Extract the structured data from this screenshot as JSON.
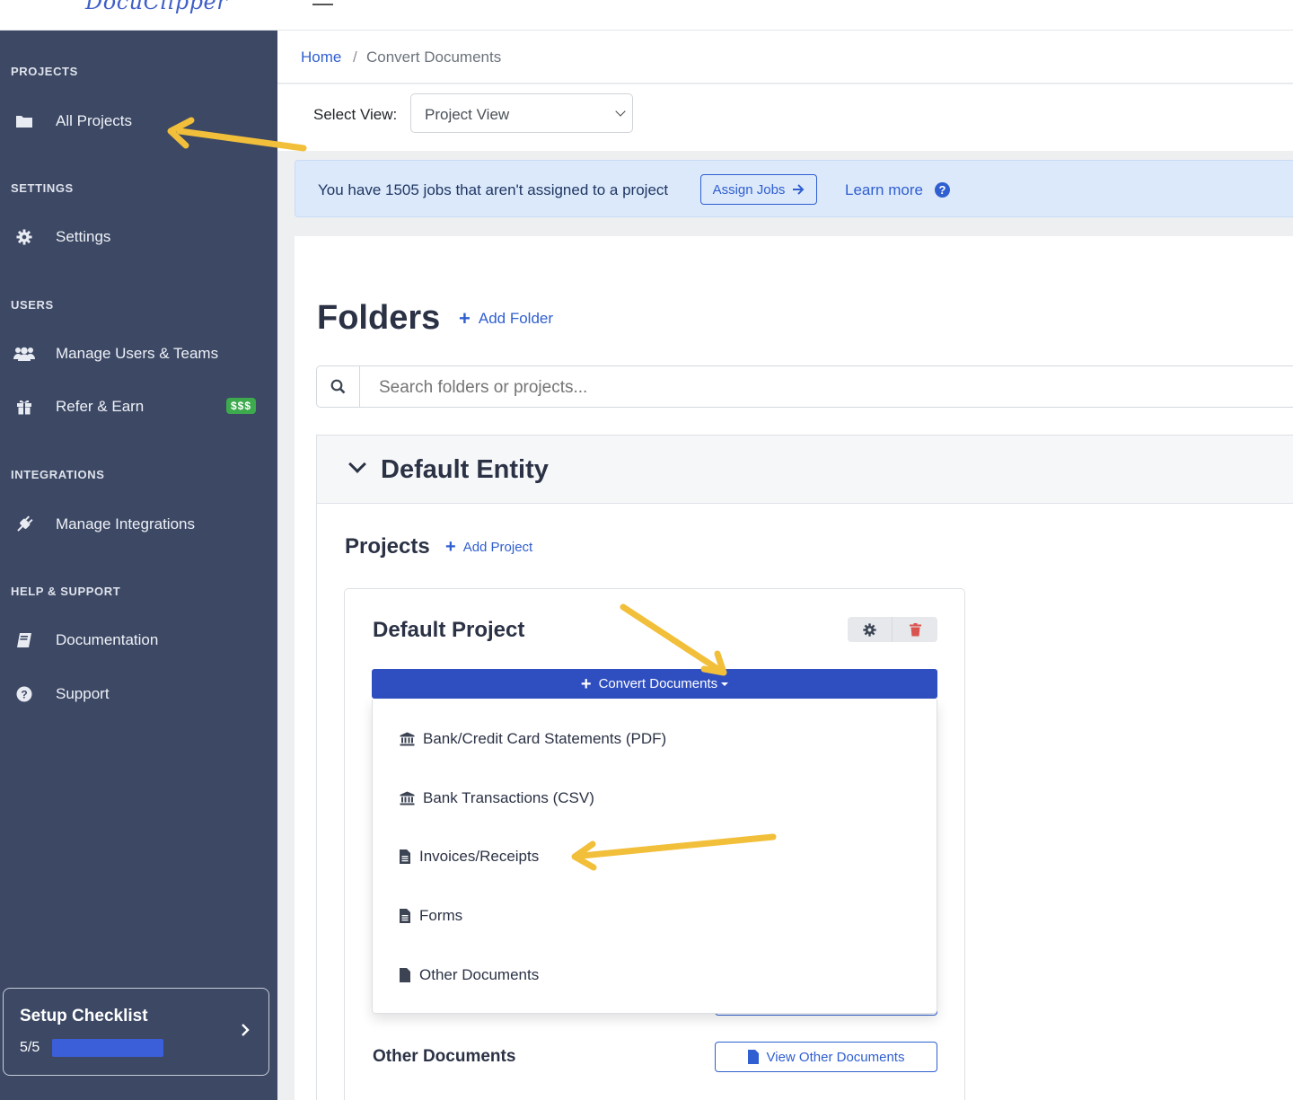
{
  "topbar": {
    "logo_text": "DocuClipper"
  },
  "sidebar": {
    "sections": [
      {
        "heading": "PROJECTS",
        "items": [
          {
            "label": "All Projects",
            "icon": "folder-icon"
          }
        ]
      },
      {
        "heading": "SETTINGS",
        "items": [
          {
            "label": "Settings",
            "icon": "gear-icon"
          }
        ]
      },
      {
        "heading": "USERS",
        "items": [
          {
            "label": "Manage Users & Teams",
            "icon": "users-icon"
          },
          {
            "label": "Refer & Earn",
            "icon": "gift-icon",
            "badge": "$$$"
          }
        ]
      },
      {
        "heading": "INTEGRATIONS",
        "items": [
          {
            "label": "Manage Integrations",
            "icon": "plug-icon"
          }
        ]
      },
      {
        "heading": "HELP & SUPPORT",
        "items": [
          {
            "label": "Documentation",
            "icon": "book-icon"
          },
          {
            "label": "Support",
            "icon": "question-circle-icon"
          }
        ]
      }
    ],
    "checklist": {
      "title": "Setup Checklist",
      "count": "5/5",
      "progress": 1.0
    }
  },
  "breadcrumb": {
    "home": "Home",
    "separator": "/",
    "current": "Convert Documents"
  },
  "view": {
    "label": "Select View:",
    "selected": "Project View"
  },
  "alert": {
    "text": "You have 1505 jobs that aren't assigned to a project",
    "assign_button": "Assign Jobs",
    "learn_more": "Learn more"
  },
  "folders": {
    "title": "Folders",
    "add_folder": "Add Folder",
    "search_placeholder": "Search folders or projects..."
  },
  "entity": {
    "title": "Default Entity",
    "projects_title": "Projects",
    "add_project": "Add Project",
    "project": {
      "title": "Default Project",
      "convert_button": "Convert Documents",
      "menu": [
        {
          "label": "Bank/Credit Card Statements (PDF)",
          "icon": "bank-icon"
        },
        {
          "label": "Bank Transactions (CSV)",
          "icon": "bank-icon"
        },
        {
          "label": "Invoices/Receipts",
          "icon": "file-text-icon"
        },
        {
          "label": "Forms",
          "icon": "file-text-icon"
        },
        {
          "label": "Other Documents",
          "icon": "file-icon"
        }
      ],
      "other_label": "Other Documents",
      "view_other_button": "View Other Documents"
    }
  },
  "colors": {
    "sidebar_bg": "#3c4864",
    "accent": "#2f5fd0",
    "primary_button": "#2f4fc0",
    "alert_bg": "#dce9fb",
    "badge_green": "#3caa4d",
    "annotation_arrow": "#f2bf3a",
    "trash_red": "#d9534f"
  }
}
